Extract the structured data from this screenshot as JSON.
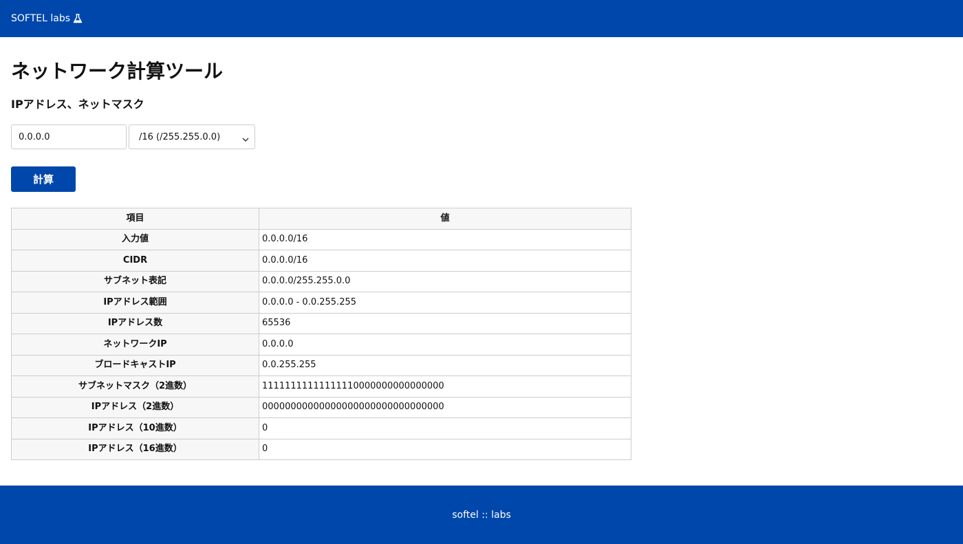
{
  "header": {
    "brand": "SOFTEL labs",
    "brand_icon": "flask-icon"
  },
  "main": {
    "title": "ネットワーク計算ツール",
    "section_title": "IPアドレス、ネットマスク",
    "ip_input": {
      "value": "0.0.0.0"
    },
    "netmask_select": {
      "selected": "/16 (/255.255.0.0)"
    },
    "calc_button_label": "計算"
  },
  "table": {
    "headers": [
      "項目",
      "値"
    ],
    "rows": [
      {
        "label": "入力値",
        "value": "0.0.0.0/16"
      },
      {
        "label": "CIDR",
        "value": "0.0.0.0/16"
      },
      {
        "label": "サブネット表記",
        "value": "0.0.0.0/255.255.0.0"
      },
      {
        "label": "IPアドレス範囲",
        "value": "0.0.0.0 - 0.0.255.255"
      },
      {
        "label": "IPアドレス数",
        "value": "65536"
      },
      {
        "label": "ネットワークIP",
        "value": "0.0.0.0"
      },
      {
        "label": "ブロードキャストIP",
        "value": "0.0.255.255"
      },
      {
        "label": "サブネットマスク（2進数）",
        "value": "11111111111111110000000000000000"
      },
      {
        "label": "IPアドレス（2進数）",
        "value": "00000000000000000000000000000000"
      },
      {
        "label": "IPアドレス（10進数）",
        "value": "0"
      },
      {
        "label": "IPアドレス（16進数）",
        "value": "0"
      }
    ]
  },
  "footer": {
    "text": "softel :: labs"
  },
  "colors": {
    "brand": "#0047ab",
    "header_cell_bg": "#f7f7f7",
    "border": "#cccccc"
  }
}
